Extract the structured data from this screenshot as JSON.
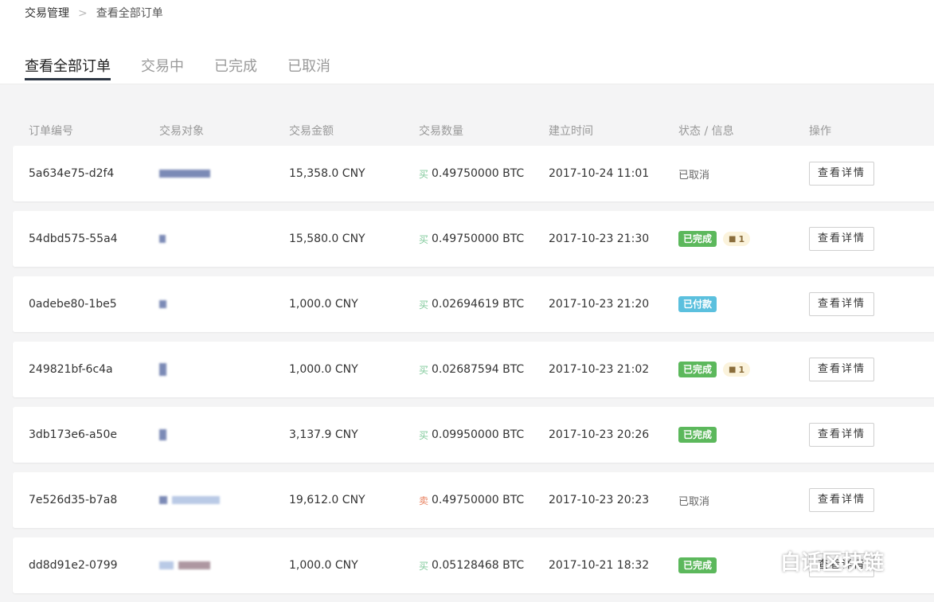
{
  "breadcrumb": {
    "root": "交易管理",
    "separator": ">",
    "current": "查看全部订单"
  },
  "tabs": [
    {
      "label": "查看全部订单",
      "active": true
    },
    {
      "label": "交易中",
      "active": false
    },
    {
      "label": "已完成",
      "active": false
    },
    {
      "label": "已取消",
      "active": false
    }
  ],
  "columns": {
    "id": "订单编号",
    "target": "交易对象",
    "amount": "交易金额",
    "qty": "交易数量",
    "time": "建立时间",
    "status": "状态 / 信息",
    "op": "操作"
  },
  "orders": [
    {
      "id": "5a634e75-d2f4",
      "amount": "15,358.0 CNY",
      "side": "买",
      "qty": "0.49750000 BTC",
      "time": "2017-10-24 11:01",
      "status": "已取消",
      "button": "查看详情"
    },
    {
      "id": "54dbd575-55a4",
      "amount": "15,580.0 CNY",
      "side": "买",
      "qty": "0.49750000 BTC",
      "time": "2017-10-23 21:30",
      "status": "已完成",
      "messages": "1",
      "button": "查看详情"
    },
    {
      "id": "0adebe80-1be5",
      "amount": "1,000.0 CNY",
      "side": "买",
      "qty": "0.02694619 BTC",
      "time": "2017-10-23 21:20",
      "status": "已付款",
      "button": "查看详情"
    },
    {
      "id": "249821bf-6c4a",
      "amount": "1,000.0 CNY",
      "side": "买",
      "qty": "0.02687594 BTC",
      "time": "2017-10-23 21:02",
      "status": "已完成",
      "messages": "1",
      "button": "查看详情"
    },
    {
      "id": "3db173e6-a50e",
      "amount": "3,137.9 CNY",
      "side": "买",
      "qty": "0.09950000 BTC",
      "time": "2017-10-23 20:26",
      "status": "已完成",
      "button": "查看详情"
    },
    {
      "id": "7e526d35-b7a8",
      "amount": "19,612.0 CNY",
      "side": "卖",
      "qty": "0.49750000 BTC",
      "time": "2017-10-23 20:23",
      "status": "已取消",
      "button": "查看详情"
    },
    {
      "id": "dd8d91e2-0799",
      "amount": "1,000.0 CNY",
      "side": "买",
      "qty": "0.05128468 BTC",
      "time": "2017-10-21 18:32",
      "status": "已完成",
      "button": "查看详情"
    }
  ],
  "watermark": {
    "text": "白话区块链",
    "icon": "wechat-icon"
  },
  "colors": {
    "done": "#5cb85c",
    "paid": "#5bc0de",
    "buy": "#7fc99a",
    "sell": "#e8805f",
    "tab_underline": "#2d3643"
  }
}
